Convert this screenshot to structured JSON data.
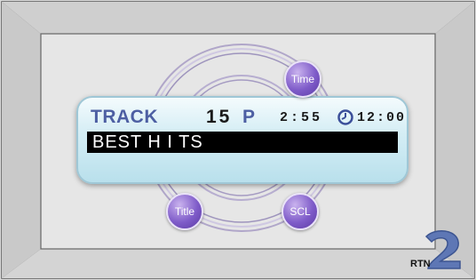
{
  "display": {
    "track_label": "TRACK",
    "track_number": "15",
    "preset": "P",
    "elapsed": "2:55",
    "clock": "12:00",
    "title": "BEST H I TS"
  },
  "buttons": {
    "time": "Time",
    "title": "Title",
    "scl": "SCL",
    "rtn": "RTN"
  },
  "icons": {
    "clock": "clock-icon",
    "return": "return-arrow-icon"
  }
}
